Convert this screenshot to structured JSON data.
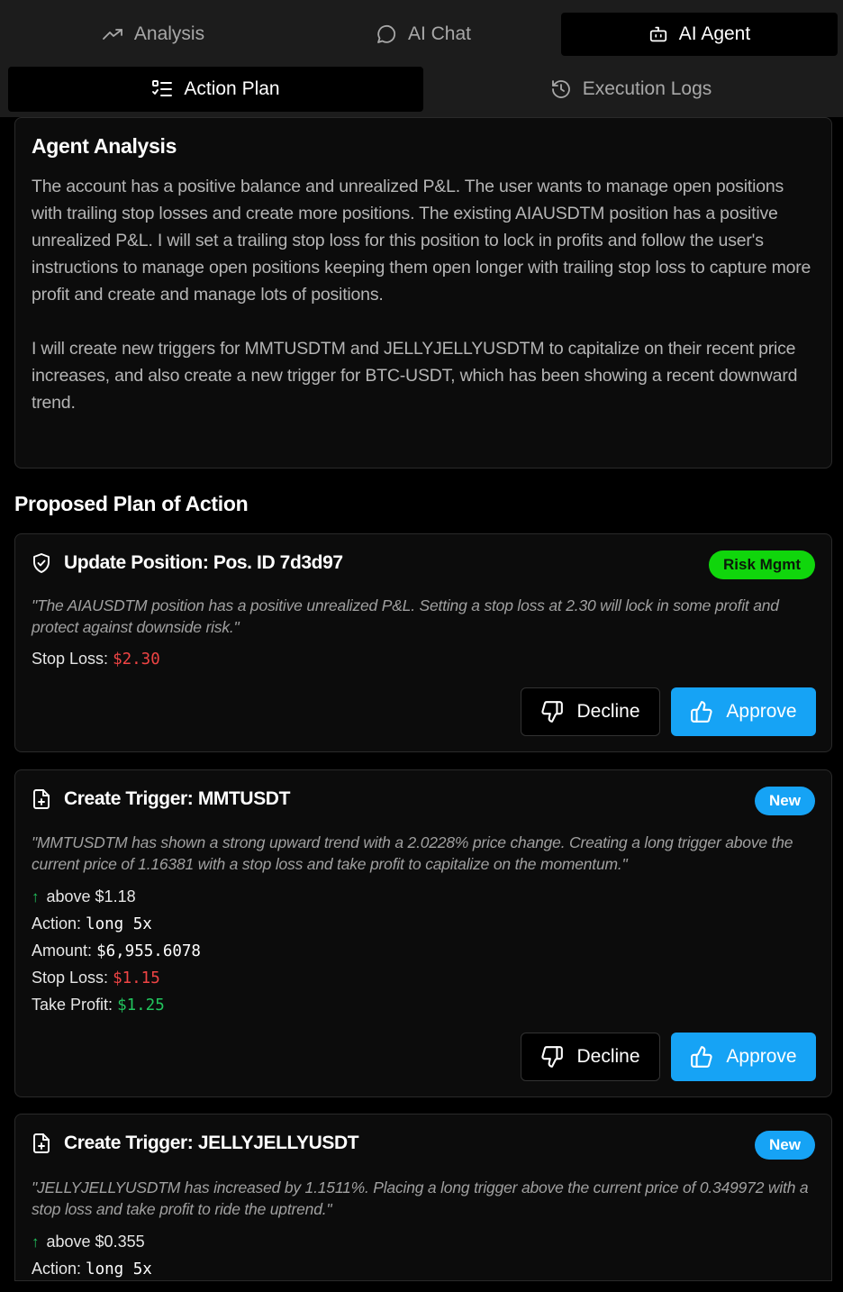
{
  "tabs": {
    "analysis": "Analysis",
    "ai_chat": "AI Chat",
    "ai_agent": "AI Agent"
  },
  "subtabs": {
    "action_plan": "Action Plan",
    "execution_logs": "Execution Logs"
  },
  "agent_analysis": {
    "title": "Agent Analysis",
    "paragraph1": "The account has a positive balance and unrealized P&L. The user wants to manage open positions with trailing stop losses and create more positions. The existing AIAUSDTM position has a positive unrealized P&L. I will set a trailing stop loss for this position to lock in profits and follow the user's instructions to manage open positions keeping them open longer with trailing stop loss to capture more profit and create and manage lots of positions.",
    "paragraph2": "I will create new triggers for MMTUSDTM and JELLYJELLYUSDTM to capitalize on their recent price increases, and also create a new trigger for BTC-USDT, which has been showing a recent downward trend."
  },
  "plan": {
    "title": "Proposed Plan of Action",
    "decline_label": "Decline",
    "approve_label": "Approve",
    "items": [
      {
        "title": "Update Position: Pos. ID 7d3d97",
        "badge": "Risk Mgmt",
        "reason": "\"The AIAUSDTM position has a positive unrealized P&L. Setting a stop loss at 2.30 will lock in some profit and protect against downside risk.\"",
        "stop_loss_label": "Stop Loss:",
        "stop_loss_value": "$2.30"
      },
      {
        "title": "Create Trigger: MMTUSDT",
        "badge": "New",
        "reason": "\"MMTUSDTM has shown a strong upward trend with a 2.0228% price change. Creating a long trigger above the current price of 1.16381 with a stop loss and take profit to capitalize on the momentum.\"",
        "condition": "above $1.18",
        "action_label": "Action:",
        "action_value": "long 5x",
        "amount_label": "Amount:",
        "amount_value": "$6,955.6078",
        "stop_loss_label": "Stop Loss:",
        "stop_loss_value": "$1.15",
        "take_profit_label": "Take Profit:",
        "take_profit_value": "$1.25"
      },
      {
        "title": "Create Trigger: JELLYJELLYUSDT",
        "badge": "New",
        "reason": "\"JELLYJELLYUSDTM has increased by 1.1511%. Placing a long trigger above the current price of 0.349972 with a stop loss and take profit to ride the uptrend.\"",
        "condition": "above $0.355",
        "action_label": "Action:",
        "action_value": "long 5x"
      }
    ]
  },
  "colors": {
    "accent_blue": "#16a3f5",
    "risk_green": "#10d60c",
    "loss_red": "#ef4444",
    "profit_green": "#22c55e"
  }
}
